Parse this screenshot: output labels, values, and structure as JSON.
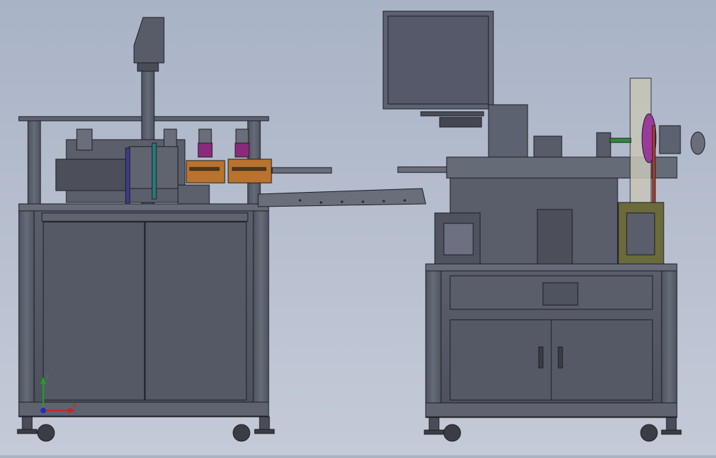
{
  "viewport": {
    "background": "#b5bdcc",
    "metal_color": "#5d6270",
    "dark_metal": "#3a3d46",
    "edge_color": "#1c1d22",
    "accent_orange": "#b8732e",
    "accent_magenta": "#8a2a7a",
    "accent_green": "#2f8a3a",
    "accent_red": "#c0392b"
  },
  "triad": {
    "x_label": "X",
    "y_label": "Y",
    "x_color": "#d02020",
    "y_color": "#20a020",
    "z_color": "#2030c0"
  },
  "components": {
    "left_machine": "left-assembly-machine",
    "right_machine": "right-assembly-machine",
    "monitor": "monitor-screen",
    "conveyor": "transfer-rail",
    "camera": "camera-mast",
    "spool": "tape-reel"
  }
}
